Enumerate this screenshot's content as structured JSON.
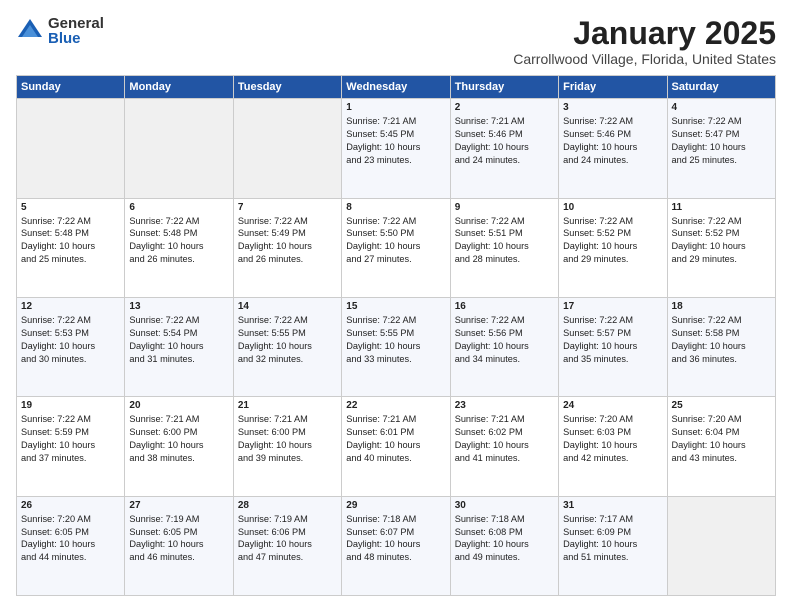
{
  "logo": {
    "general": "General",
    "blue": "Blue"
  },
  "header": {
    "title": "January 2025",
    "subtitle": "Carrollwood Village, Florida, United States"
  },
  "weekdays": [
    "Sunday",
    "Monday",
    "Tuesday",
    "Wednesday",
    "Thursday",
    "Friday",
    "Saturday"
  ],
  "weeks": [
    [
      {
        "day": "",
        "info": ""
      },
      {
        "day": "",
        "info": ""
      },
      {
        "day": "",
        "info": ""
      },
      {
        "day": "1",
        "info": "Sunrise: 7:21 AM\nSunset: 5:45 PM\nDaylight: 10 hours\nand 23 minutes."
      },
      {
        "day": "2",
        "info": "Sunrise: 7:21 AM\nSunset: 5:46 PM\nDaylight: 10 hours\nand 24 minutes."
      },
      {
        "day": "3",
        "info": "Sunrise: 7:22 AM\nSunset: 5:46 PM\nDaylight: 10 hours\nand 24 minutes."
      },
      {
        "day": "4",
        "info": "Sunrise: 7:22 AM\nSunset: 5:47 PM\nDaylight: 10 hours\nand 25 minutes."
      }
    ],
    [
      {
        "day": "5",
        "info": "Sunrise: 7:22 AM\nSunset: 5:48 PM\nDaylight: 10 hours\nand 25 minutes."
      },
      {
        "day": "6",
        "info": "Sunrise: 7:22 AM\nSunset: 5:48 PM\nDaylight: 10 hours\nand 26 minutes."
      },
      {
        "day": "7",
        "info": "Sunrise: 7:22 AM\nSunset: 5:49 PM\nDaylight: 10 hours\nand 26 minutes."
      },
      {
        "day": "8",
        "info": "Sunrise: 7:22 AM\nSunset: 5:50 PM\nDaylight: 10 hours\nand 27 minutes."
      },
      {
        "day": "9",
        "info": "Sunrise: 7:22 AM\nSunset: 5:51 PM\nDaylight: 10 hours\nand 28 minutes."
      },
      {
        "day": "10",
        "info": "Sunrise: 7:22 AM\nSunset: 5:52 PM\nDaylight: 10 hours\nand 29 minutes."
      },
      {
        "day": "11",
        "info": "Sunrise: 7:22 AM\nSunset: 5:52 PM\nDaylight: 10 hours\nand 29 minutes."
      }
    ],
    [
      {
        "day": "12",
        "info": "Sunrise: 7:22 AM\nSunset: 5:53 PM\nDaylight: 10 hours\nand 30 minutes."
      },
      {
        "day": "13",
        "info": "Sunrise: 7:22 AM\nSunset: 5:54 PM\nDaylight: 10 hours\nand 31 minutes."
      },
      {
        "day": "14",
        "info": "Sunrise: 7:22 AM\nSunset: 5:55 PM\nDaylight: 10 hours\nand 32 minutes."
      },
      {
        "day": "15",
        "info": "Sunrise: 7:22 AM\nSunset: 5:55 PM\nDaylight: 10 hours\nand 33 minutes."
      },
      {
        "day": "16",
        "info": "Sunrise: 7:22 AM\nSunset: 5:56 PM\nDaylight: 10 hours\nand 34 minutes."
      },
      {
        "day": "17",
        "info": "Sunrise: 7:22 AM\nSunset: 5:57 PM\nDaylight: 10 hours\nand 35 minutes."
      },
      {
        "day": "18",
        "info": "Sunrise: 7:22 AM\nSunset: 5:58 PM\nDaylight: 10 hours\nand 36 minutes."
      }
    ],
    [
      {
        "day": "19",
        "info": "Sunrise: 7:22 AM\nSunset: 5:59 PM\nDaylight: 10 hours\nand 37 minutes."
      },
      {
        "day": "20",
        "info": "Sunrise: 7:21 AM\nSunset: 6:00 PM\nDaylight: 10 hours\nand 38 minutes."
      },
      {
        "day": "21",
        "info": "Sunrise: 7:21 AM\nSunset: 6:00 PM\nDaylight: 10 hours\nand 39 minutes."
      },
      {
        "day": "22",
        "info": "Sunrise: 7:21 AM\nSunset: 6:01 PM\nDaylight: 10 hours\nand 40 minutes."
      },
      {
        "day": "23",
        "info": "Sunrise: 7:21 AM\nSunset: 6:02 PM\nDaylight: 10 hours\nand 41 minutes."
      },
      {
        "day": "24",
        "info": "Sunrise: 7:20 AM\nSunset: 6:03 PM\nDaylight: 10 hours\nand 42 minutes."
      },
      {
        "day": "25",
        "info": "Sunrise: 7:20 AM\nSunset: 6:04 PM\nDaylight: 10 hours\nand 43 minutes."
      }
    ],
    [
      {
        "day": "26",
        "info": "Sunrise: 7:20 AM\nSunset: 6:05 PM\nDaylight: 10 hours\nand 44 minutes."
      },
      {
        "day": "27",
        "info": "Sunrise: 7:19 AM\nSunset: 6:05 PM\nDaylight: 10 hours\nand 46 minutes."
      },
      {
        "day": "28",
        "info": "Sunrise: 7:19 AM\nSunset: 6:06 PM\nDaylight: 10 hours\nand 47 minutes."
      },
      {
        "day": "29",
        "info": "Sunrise: 7:18 AM\nSunset: 6:07 PM\nDaylight: 10 hours\nand 48 minutes."
      },
      {
        "day": "30",
        "info": "Sunrise: 7:18 AM\nSunset: 6:08 PM\nDaylight: 10 hours\nand 49 minutes."
      },
      {
        "day": "31",
        "info": "Sunrise: 7:17 AM\nSunset: 6:09 PM\nDaylight: 10 hours\nand 51 minutes."
      },
      {
        "day": "",
        "info": ""
      }
    ]
  ]
}
